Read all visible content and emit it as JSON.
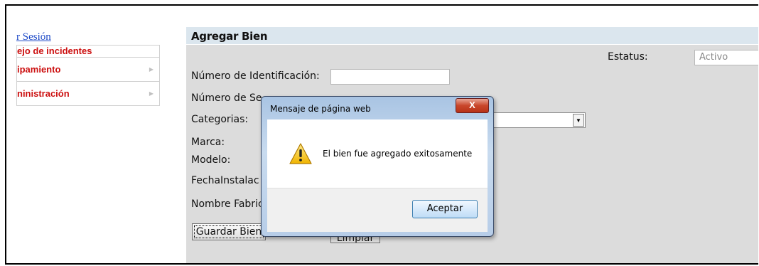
{
  "sidebar": {
    "logout_link": "r Sesión",
    "items": [
      {
        "label": "ejo de incidentes"
      },
      {
        "label": "ipamiento"
      },
      {
        "label": "ninistración"
      }
    ]
  },
  "form": {
    "title": "Agregar Bien",
    "status_label": "Estatus:",
    "status_value": "Activo",
    "fields": {
      "id_label": "Número de Identificación:",
      "serial_label": "Número de Se",
      "category_label": "Categorias:",
      "brand_label": "Marca:",
      "model_label": "Modelo:",
      "install_date_label": "FechaInstalac",
      "manufacturer_label": "Nombre Fabric"
    },
    "save_button": "Guardar Bien",
    "clear_button": "Limpiar"
  },
  "dialog": {
    "title": "Mensaje de página web",
    "close_label": "X",
    "message": "El bien fue agregado exitosamente",
    "ok_button": "Aceptar"
  },
  "colors": {
    "menu_text": "#cc1010",
    "link": "#1a47c7",
    "panel_bg": "#dcdcdc",
    "panel_header": "#dbe6ee"
  }
}
